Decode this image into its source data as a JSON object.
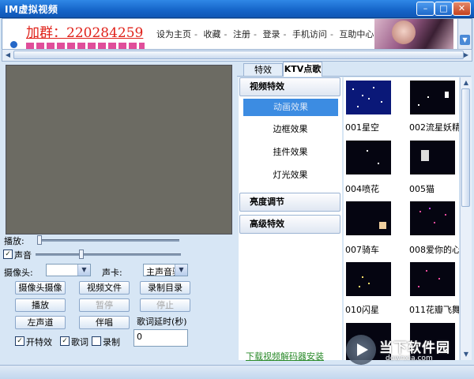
{
  "window": {
    "title": "IM虚拟视频",
    "buttons": [
      "–",
      "□",
      "✕"
    ]
  },
  "banner": {
    "qq_text": "加群：220284259",
    "nav": [
      "设为主页",
      "收藏",
      "注册",
      "登录",
      "手机访问",
      "互助中心"
    ]
  },
  "left": {
    "play_label": "播放:",
    "sound_label": "声音",
    "sound_checked": true,
    "play_level": 0.0,
    "volume_level": 0.3,
    "camera_label": "摄像头:",
    "camera_value": "",
    "soundcard_label": "声卡:",
    "soundcard_value": "主声音驱",
    "buttons": {
      "camera": "摄像头摄像",
      "video_file": "视频文件",
      "record_dir": "录制目录",
      "play": "播放",
      "pause": "暂停",
      "stop": "停止",
      "left_channel": "左声道",
      "accompany": "伴唱"
    },
    "lyrics_delay_label": "歌词延时(秒)",
    "lyrics_delay_value": "0",
    "checks": {
      "effects": "开特效",
      "lyrics": "歌词",
      "record": "录制"
    },
    "checks_state": {
      "effects": true,
      "lyrics": true,
      "record": false
    }
  },
  "right": {
    "tabs": [
      "特效",
      "KTV点歌"
    ],
    "active_tab": 1,
    "menu": {
      "video_effects": "视频特效",
      "items": [
        "动画效果",
        "边框效果",
        "挂件效果",
        "灯光效果"
      ],
      "selected": 0,
      "brightness": "亮度调节",
      "advanced": "高级特效"
    },
    "download_link": "下载视频解码器安装",
    "effects": [
      "001星空",
      "002流星妖精",
      "004喷花",
      "005猫",
      "007骑车",
      "008爱你的心",
      "010闪星",
      "011花瓣飞舞"
    ]
  },
  "watermark": {
    "title": "当下软件园",
    "url": "downxia.com"
  },
  "colors": {
    "titlebar": "#1564c8",
    "selected": "#3c8ce2",
    "link": "#2a8a2a",
    "qq": "#e0221a"
  }
}
